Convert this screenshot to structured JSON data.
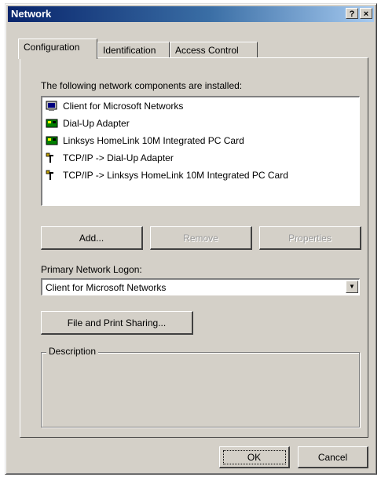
{
  "window": {
    "title": "Network",
    "help_label": "?",
    "close_label": "×"
  },
  "tabs": [
    {
      "label": "Configuration",
      "active": true
    },
    {
      "label": "Identification",
      "active": false
    },
    {
      "label": "Access Control",
      "active": false
    }
  ],
  "components": {
    "heading": "The following network components are installed:",
    "items": [
      {
        "label": "Client for Microsoft Networks",
        "icon": "client-icon"
      },
      {
        "label": "Dial-Up Adapter",
        "icon": "adapter-icon"
      },
      {
        "label": "Linksys HomeLink 10M Integrated PC Card",
        "icon": "adapter-icon"
      },
      {
        "label": "TCP/IP -> Dial-Up Adapter",
        "icon": "protocol-icon"
      },
      {
        "label": "TCP/IP -> Linksys HomeLink 10M Integrated PC Card",
        "icon": "protocol-icon"
      }
    ]
  },
  "buttons": {
    "add": "Add...",
    "remove": "Remove",
    "properties": "Properties",
    "file_print_sharing": "File and Print Sharing...",
    "ok": "OK",
    "cancel": "Cancel"
  },
  "logon": {
    "label": "Primary Network Logon:",
    "value": "Client for Microsoft Networks"
  },
  "description": {
    "label": "Description"
  }
}
